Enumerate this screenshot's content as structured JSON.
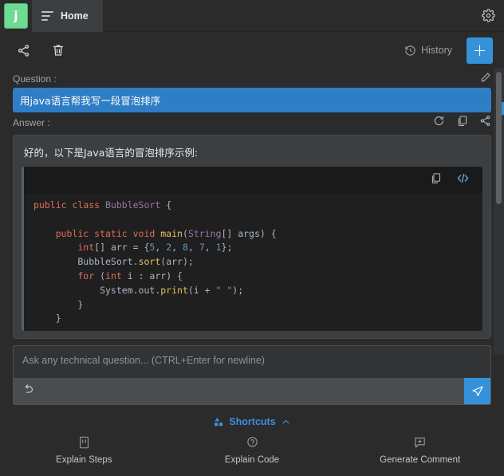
{
  "app": {
    "logo_letter": "j",
    "tab_label": "Home",
    "settings_icon": "gear-icon",
    "menu_icon": "lines-icon"
  },
  "toolbar": {
    "share_icon": "share-icon",
    "delete_icon": "trash-icon",
    "history_label": "History",
    "history_icon": "history-clock-icon",
    "new_label": "+"
  },
  "conversation": {
    "question_label": "Question :",
    "question_text": "用java语言帮我写一段冒泡排序",
    "edit_icon": "pencil-icon",
    "answer_label": "Answer :",
    "answer_tools": [
      "refresh-icon",
      "copy-icon",
      "share-icon"
    ],
    "answer_text": "好的，以下是Java语言的冒泡排序示例:",
    "code_tools": [
      "copy-icon",
      "code-brackets-icon"
    ],
    "code_lines": [
      [
        {
          "t": "public ",
          "c": "kw"
        },
        {
          "t": "class ",
          "c": "kw"
        },
        {
          "t": "BubbleSort",
          "c": "typ"
        },
        {
          "t": " {",
          "c": "pl"
        }
      ],
      [],
      [
        {
          "t": "    public static void ",
          "c": "kw"
        },
        {
          "t": "main",
          "c": "fn"
        },
        {
          "t": "(",
          "c": "pl"
        },
        {
          "t": "String",
          "c": "typ"
        },
        {
          "t": "[] args) {",
          "c": "pl"
        }
      ],
      [
        {
          "t": "        int",
          "c": "kw"
        },
        {
          "t": "[] arr = {",
          "c": "pl"
        },
        {
          "t": "5",
          "c": "num"
        },
        {
          "t": ", ",
          "c": "pl"
        },
        {
          "t": "2",
          "c": "num"
        },
        {
          "t": ", ",
          "c": "pl"
        },
        {
          "t": "8",
          "c": "num"
        },
        {
          "t": ", ",
          "c": "pl"
        },
        {
          "t": "7",
          "c": "num"
        },
        {
          "t": ", ",
          "c": "pl"
        },
        {
          "t": "1",
          "c": "num"
        },
        {
          "t": "};",
          "c": "pl"
        }
      ],
      [
        {
          "t": "        BubbleSort.",
          "c": "pl"
        },
        {
          "t": "sort",
          "c": "fn"
        },
        {
          "t": "(arr);",
          "c": "pl"
        }
      ],
      [
        {
          "t": "        for ",
          "c": "kw"
        },
        {
          "t": "(",
          "c": "pl"
        },
        {
          "t": "int",
          "c": "kw"
        },
        {
          "t": " i : arr) {",
          "c": "pl"
        }
      ],
      [
        {
          "t": "            System.out.",
          "c": "pl"
        },
        {
          "t": "print",
          "c": "fn"
        },
        {
          "t": "(i + ",
          "c": "pl"
        },
        {
          "t": "\" \"",
          "c": "str"
        },
        {
          "t": ");",
          "c": "pl"
        }
      ],
      [
        {
          "t": "        }",
          "c": "pl"
        }
      ],
      [
        {
          "t": "    }",
          "c": "pl"
        }
      ]
    ]
  },
  "prompt": {
    "placeholder": "Ask any technical question... (CTRL+Enter for newline)",
    "value": "",
    "undo_icon": "undo-arrow-icon",
    "send_icon": "send-plane-icon"
  },
  "shortcuts": {
    "title": "Shortcuts",
    "toggle_icon": "chevron-up-icon",
    "items": [
      {
        "label": "Explain Steps",
        "icon": "explain-steps-icon"
      },
      {
        "label": "Explain Code",
        "icon": "explain-code-icon"
      },
      {
        "label": "Generate Comment",
        "icon": "generate-comment-icon"
      }
    ]
  },
  "colors": {
    "accent_blue": "#3592d9",
    "logo_green": "#6fdb92",
    "question_blue": "#2f7dc4",
    "panel_bg": "#3c3f41",
    "code_bg": "#1f1f1f"
  }
}
